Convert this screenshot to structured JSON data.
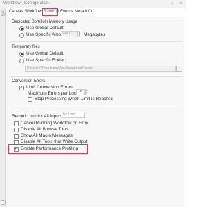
{
  "window": {
    "title": "Workflow - Configuration",
    "pin_icon": "pin-icon",
    "close_icon": "close-icon"
  },
  "sidebar": {
    "icons": [
      "gear-icon",
      "help-icon"
    ]
  },
  "tabs": [
    {
      "label": "Canvas"
    },
    {
      "label": "Workflow"
    },
    {
      "label": "Runtime"
    },
    {
      "label": "Events"
    },
    {
      "label": "Meta Info"
    }
  ],
  "active_tab": "Runtime",
  "dedicated_memory": {
    "title": "Dedicated Sort/Join Memory Usage",
    "use_global": "Use Global Default",
    "use_specific": "Use Specific Amount:",
    "amount": "4041",
    "unit": "Megabytes"
  },
  "temporary_files": {
    "title": "Temporary files",
    "use_global": "Use Global Default",
    "use_specific": "Use Specific Folder:",
    "folder": "C:\\Users\\Theo Isaac\\AppData\\Local\\Temp\\",
    "browse": "..."
  },
  "conversion_errors": {
    "title": "Conversion Errors",
    "limit": "Limit Conversion Errors",
    "max_label": "Maximum Errors per Location:",
    "max_value": "10",
    "stop": "Stop Processing When Limit is Reached"
  },
  "record_limit": {
    "label": "Record Limit for All Inputs:",
    "placeholder": "No Limit"
  },
  "options": [
    {
      "label": "Cancel Running Workflow on Error",
      "checked": false
    },
    {
      "label": "Disable All Browse Tools",
      "checked": false
    },
    {
      "label": "Show All Macro Messages",
      "checked": false
    },
    {
      "label": "Disable All Tools that Write Output",
      "checked": false
    },
    {
      "label": "Enable Performance Profiling",
      "checked": true
    }
  ],
  "colors": {
    "accent": "#3b7fc4",
    "highlight": "#e53945"
  }
}
